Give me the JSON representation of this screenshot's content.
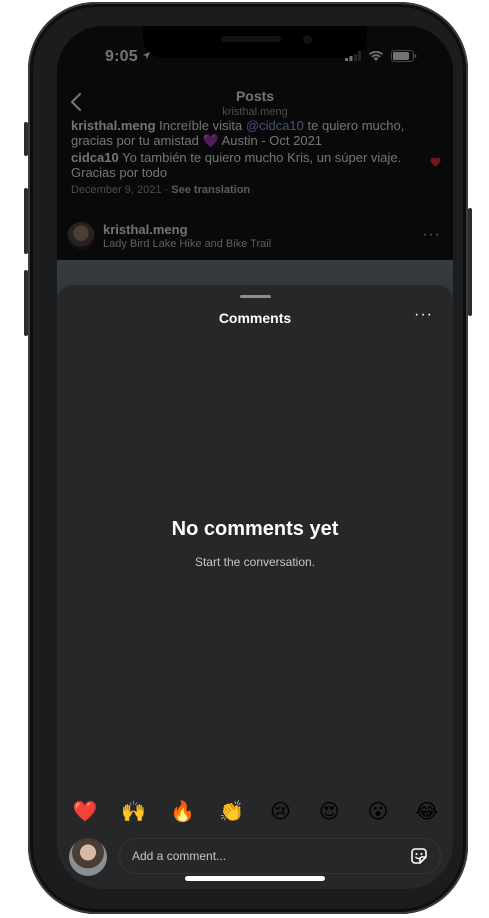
{
  "status_bar": {
    "time": "9:05"
  },
  "nav": {
    "title": "Posts",
    "subtitle": "kristhal.meng"
  },
  "caption": {
    "user": "kristhal.meng",
    "text_before": "Increíble visita",
    "mention": "@cidca10",
    "text_after": "te quiero mucho, gracias por tu amistad 💜 Austin - Oct 2021"
  },
  "comment": {
    "user": "cidca10",
    "text": "Yo también te quiero mucho Kris, un súper viaje. Gracias por todo",
    "date": "December 9, 2021",
    "separator": "·",
    "see_translation": "See translation"
  },
  "post": {
    "user": "kristhal.meng",
    "location": "Lady Bird Lake Hike and Bike Trail",
    "more": "···"
  },
  "sheet": {
    "title": "Comments",
    "more": "···",
    "empty_title": "No comments yet",
    "empty_subtitle": "Start the conversation."
  },
  "reactions": [
    "❤️",
    "🙌",
    "🔥",
    "👏",
    "😢",
    "😍",
    "😮",
    "😂"
  ],
  "composer": {
    "placeholder": "Add a comment..."
  },
  "icons": {
    "back": "chevron-left-icon",
    "sticker": "sticker-icon",
    "heart": "heart-icon"
  },
  "colors": {
    "sheet_bg": "#262729",
    "accent_heart": "#ff3040"
  }
}
